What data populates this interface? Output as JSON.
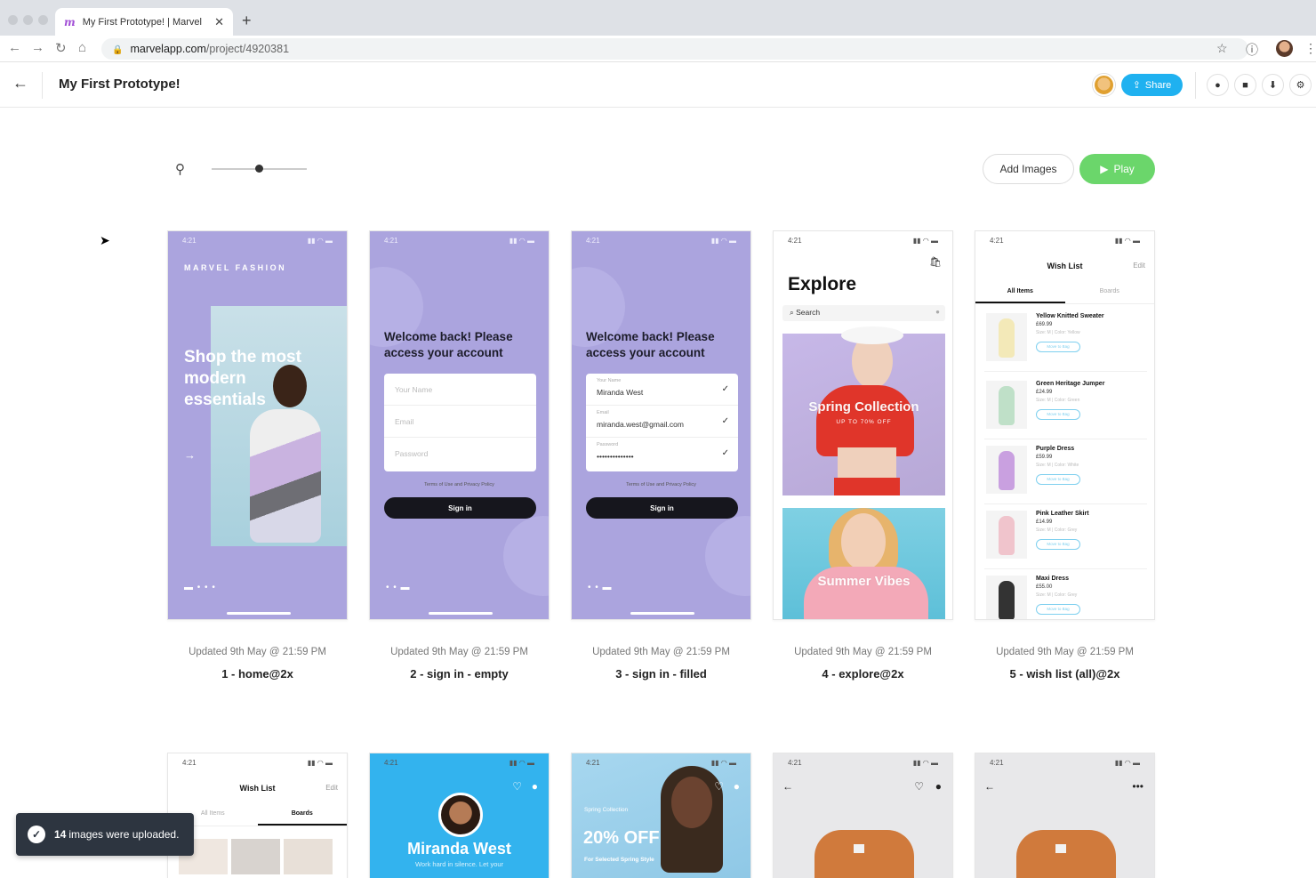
{
  "browser": {
    "tab_title": "My First Prototype! | Marvel",
    "url_host": "marvelapp.com",
    "url_path": "/project/4920381"
  },
  "header": {
    "project_title": "My First Prototype!",
    "share_label": "Share"
  },
  "toolbar": {
    "add_images_label": "Add Images",
    "play_label": "Play",
    "zoom_level": 0.5
  },
  "screens": [
    {
      "updated": "Updated 9th May @ 21:59 PM",
      "name": "1 - home@2x"
    },
    {
      "updated": "Updated 9th May @ 21:59 PM",
      "name": "2 - sign in - empty"
    },
    {
      "updated": "Updated 9th May @ 21:59 PM",
      "name": "3 - sign in - filled"
    },
    {
      "updated": "Updated 9th May @ 21:59 PM",
      "name": "4 - explore@2x"
    },
    {
      "updated": "Updated 9th May @ 21:59 PM",
      "name": "5 - wish list (all)@2x"
    }
  ],
  "mock": {
    "time": "4:21",
    "home": {
      "brand": "MARVEL FASHION",
      "hero": "Shop the most modern essentials"
    },
    "signin": {
      "welcome": "Welcome back! Please access your account",
      "name_placeholder": "Your Name",
      "email_placeholder": "Email",
      "password_placeholder": "Password",
      "name_label": "Your Name",
      "email_label": "Email",
      "password_label": "Password",
      "name_value": "Miranda West",
      "email_value": "miranda.west@gmail.com",
      "password_value": "••••••••••••••",
      "terms": "Terms of Use and Privacy Policy",
      "button": "Sign in"
    },
    "explore": {
      "title": "Explore",
      "search": "Search",
      "spring": "Spring Collection",
      "spring_sub": "UP TO 70% OFF",
      "summer": "Summer Vibes"
    },
    "wishlist": {
      "title": "Wish List",
      "edit": "Edit",
      "tab_all": "All Items",
      "tab_boards": "Boards",
      "move": "Move to Bag",
      "items": [
        {
          "name": "Yellow Knitted Sweater",
          "price": "£69.99",
          "opts": "Size: M  |  Color: Yellow",
          "color": "#f3e9b8"
        },
        {
          "name": "Green Heritage Jumper",
          "price": "£24.99",
          "opts": "Size: M  |  Color: Green",
          "color": "#bfe0c8"
        },
        {
          "name": "Purple Dress",
          "price": "£59.99",
          "opts": "Size: M  |  Color: White",
          "color": "#c9a0e0"
        },
        {
          "name": "Pink Leather Skirt",
          "price": "£14.99",
          "opts": "Size: M  |  Color: Grey",
          "color": "#f0c4cc"
        },
        {
          "name": "Maxi Dress",
          "price": "£55.00",
          "opts": "Size: M  |  Color: Grey",
          "color": "#333333"
        }
      ]
    },
    "profile": {
      "name": "Miranda West",
      "sub": "Work hard in silence. Let your"
    },
    "promo": {
      "collection": "Spring Collection",
      "off": "20% OFF",
      "sub": "For Selected Spring Style"
    }
  },
  "toast": {
    "count": "14",
    "message": "images were uploaded."
  }
}
